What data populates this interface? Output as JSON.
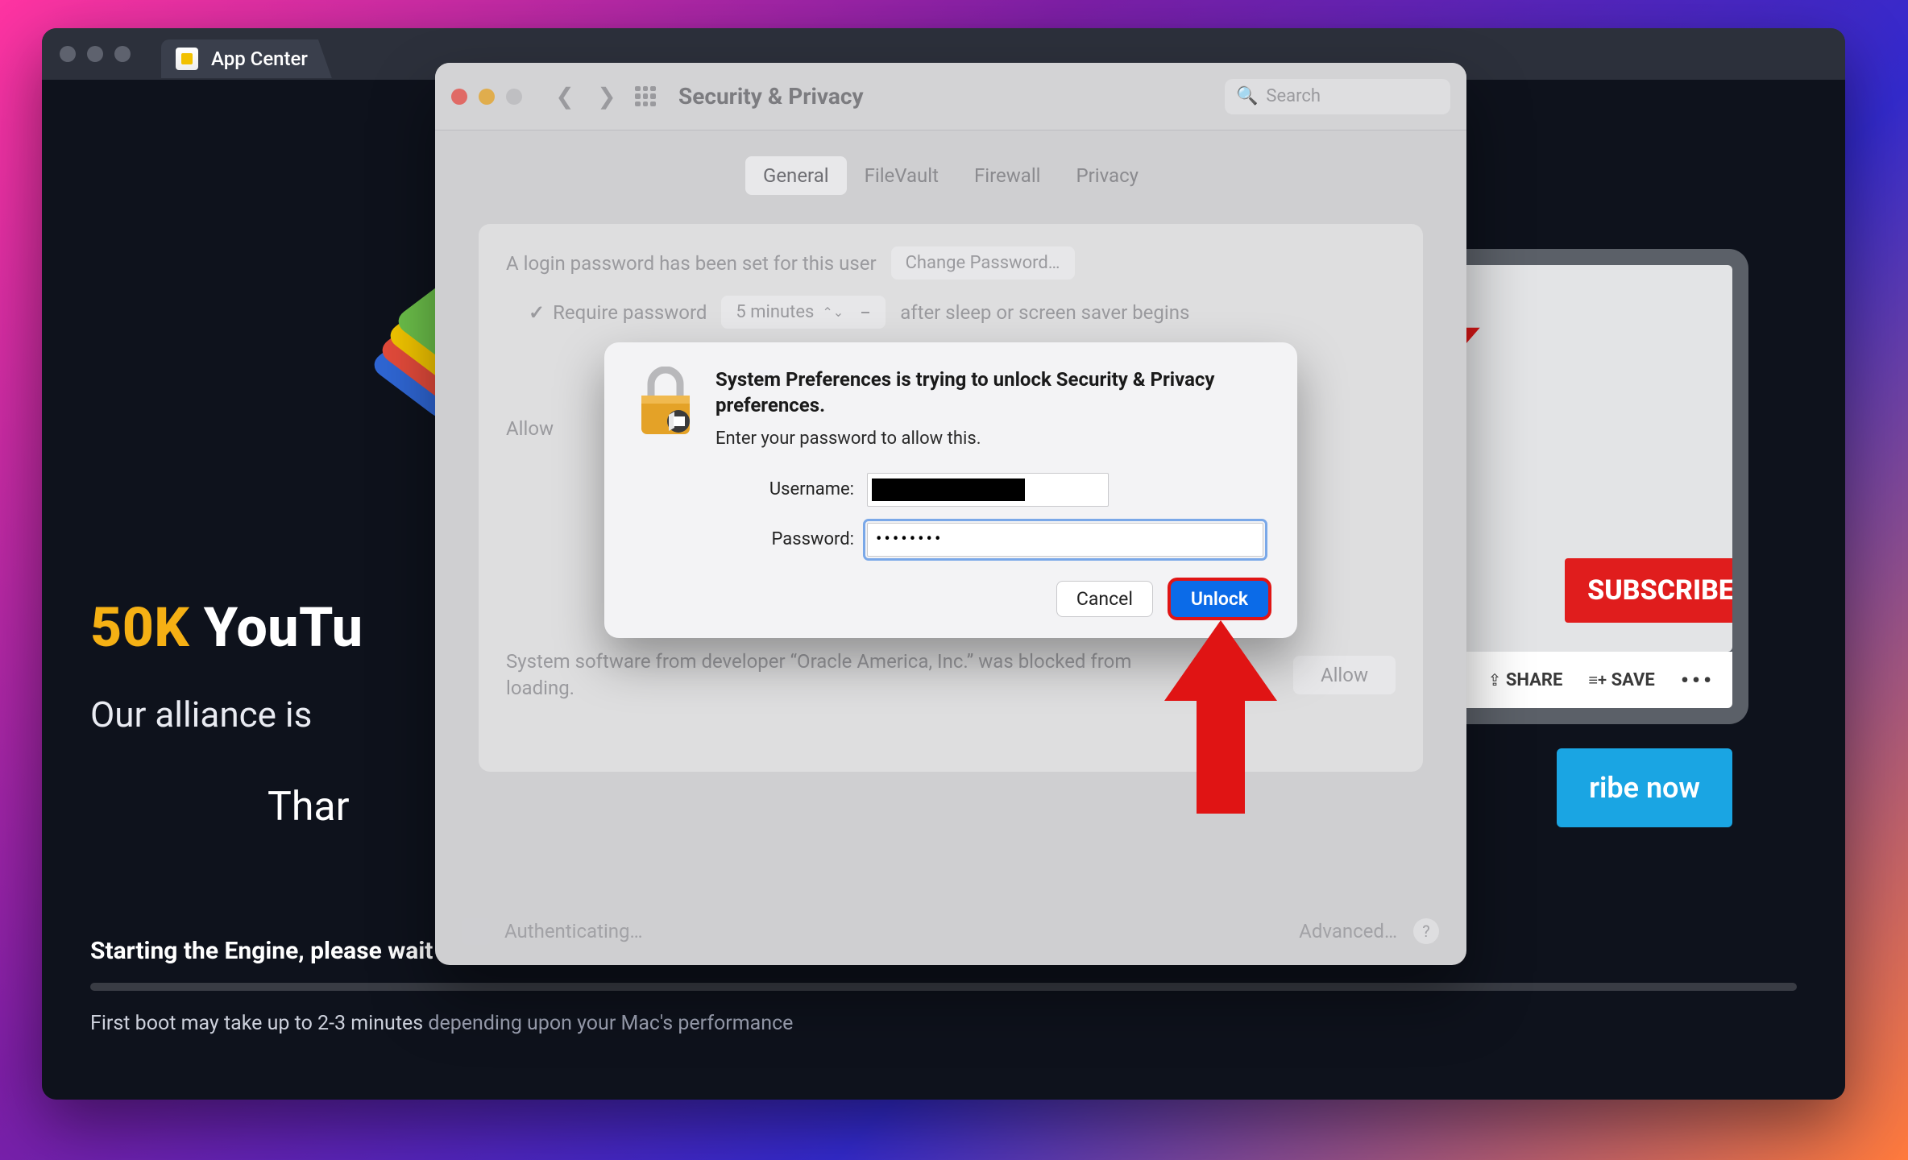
{
  "app_window": {
    "tab_label": "App Center",
    "promo": {
      "headline_gold": "50K",
      "headline_rest": " YouTu",
      "subline": "Our alliance is",
      "thanks": "Thar"
    },
    "device_bar": {
      "share": "SHARE",
      "save_prefix": "≡+",
      "save": "SAVE",
      "more": "•••"
    },
    "subscribe_badge": "SUBSCRIBE",
    "cta": "ribe now",
    "status_title": "Starting the Engine, please wait",
    "status_note_strong": "First boot may take up to 2-3 minutes ",
    "status_note_faded": "depending upon your Mac's performance"
  },
  "pref": {
    "title": "Security & Privacy",
    "search_placeholder": "Search",
    "tabs": {
      "general": "General",
      "filevault": "FileVault",
      "firewall": "Firewall",
      "privacy": "Privacy"
    },
    "line_login": "A login password has been set for this user",
    "btn_change_pw": "Change Password…",
    "chk_require": "Require password",
    "dropdown_delay": "5 minutes",
    "after_sleep": "after sleep or screen saver begins",
    "allow_label": "Allow",
    "blocked_text": "System software from developer “Oracle America, Inc.” was blocked from loading.",
    "btn_allow": "Allow",
    "footer_status": "Authenticating…",
    "footer_advanced": "Advanced…"
  },
  "auth": {
    "heading": "System Preferences is trying to unlock Security & Privacy preferences.",
    "sub": "Enter your password to allow this.",
    "label_user": "Username:",
    "label_pass": "Password:",
    "value_pass": "••••••••",
    "btn_cancel": "Cancel",
    "btn_unlock": "Unlock"
  }
}
